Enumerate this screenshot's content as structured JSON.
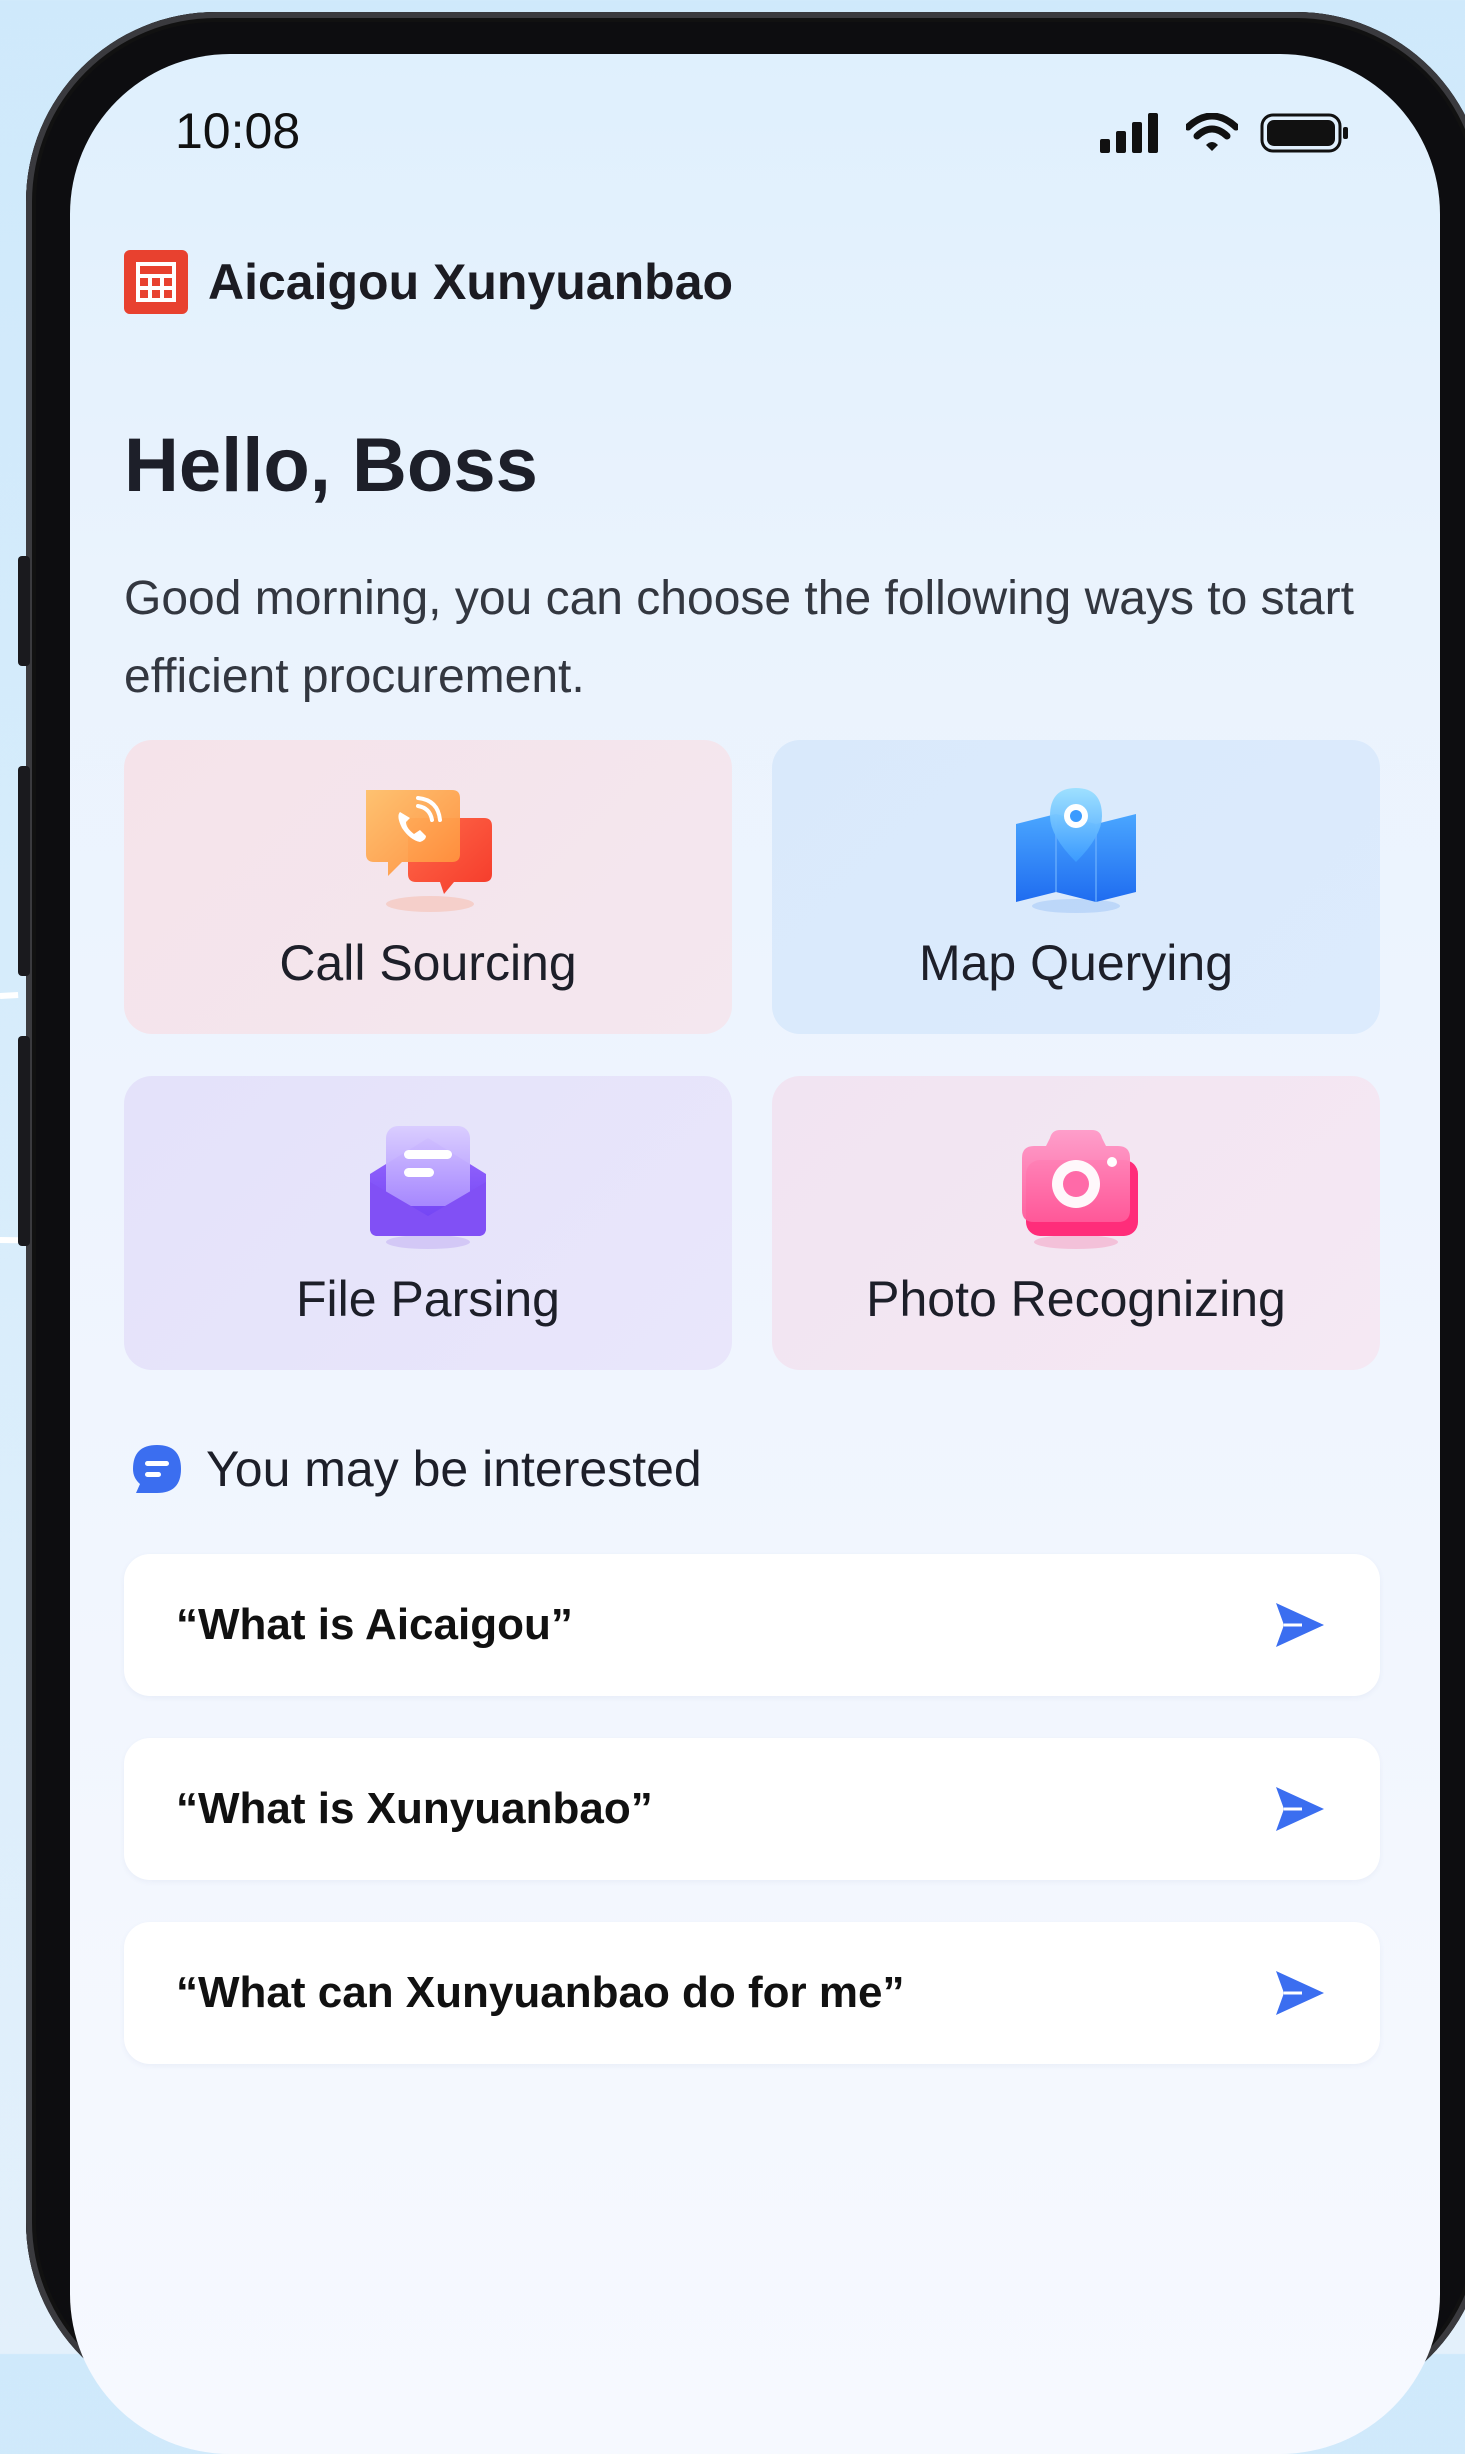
{
  "status_bar": {
    "time": "10:08",
    "icons": [
      "signal-icon",
      "wifi-icon",
      "battery-icon"
    ]
  },
  "brand": {
    "name": "Aicaigou Xunyuanbao",
    "logo_icon": "aicaigou-logo-icon",
    "color": "#e8412f"
  },
  "greeting": "Hello, Boss",
  "subtitle": "Good morning, you can choose the following ways to start efficient procurement.",
  "features": [
    {
      "label": "Call Sourcing",
      "icon": "phone-chat-icon"
    },
    {
      "label": "Map Querying",
      "icon": "map-pin-icon"
    },
    {
      "label": "File Parsing",
      "icon": "envelope-document-icon"
    },
    {
      "label": "Photo Recognizing",
      "icon": "camera-icon"
    }
  ],
  "interest": {
    "title": "You may be interested",
    "icon": "chat-bubble-icon"
  },
  "questions": [
    {
      "text": "“What is Aicaigou”",
      "icon": "send-icon"
    },
    {
      "text": "“What is Xunyuanbao”",
      "icon": "send-icon"
    },
    {
      "text": "“What can Xunyuanbao do for me”",
      "icon": "send-icon"
    }
  ],
  "colors": {
    "accent": "#3b6ef0",
    "text_primary": "#1d1f29"
  }
}
